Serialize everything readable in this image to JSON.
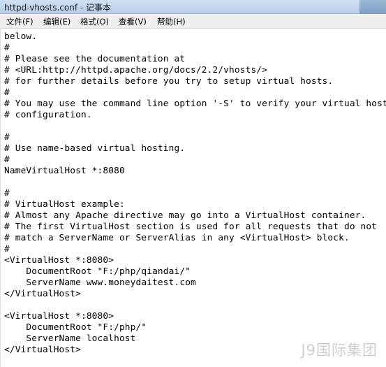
{
  "window": {
    "title": "httpd-vhosts.conf - 记事本"
  },
  "menu": [
    {
      "label": "文件(F)"
    },
    {
      "label": "编辑(E)"
    },
    {
      "label": "格式(O)"
    },
    {
      "label": "查看(V)"
    },
    {
      "label": "帮助(H)"
    }
  ],
  "editor": {
    "lines": [
      "below.",
      "#",
      "# Please see the documentation at",
      "# <URL:http://httpd.apache.org/docs/2.2/vhosts/>",
      "# for further details before you try to setup virtual hosts.",
      "#",
      "# You may use the command line option '-S' to verify your virtual host",
      "# configuration.",
      "",
      "#",
      "# Use name-based virtual hosting.",
      "#",
      "NameVirtualHost *:8080",
      "",
      "#",
      "# VirtualHost example:",
      "# Almost any Apache directive may go into a VirtualHost container.",
      "# The first VirtualHost section is used for all requests that do not",
      "# match a ServerName or ServerAlias in any <VirtualHost> block.",
      "#",
      "<VirtualHost *:8080>",
      "    DocumentRoot \"F:/php/qiandai/\"",
      "    ServerName www.moneydaitest.com",
      "</VirtualHost>",
      "",
      "<VirtualHost *:8080>",
      "    DocumentRoot \"F:/php/\"",
      "    ServerName localhost",
      "</VirtualHost>"
    ]
  },
  "watermark": {
    "text": "J9国际集团"
  }
}
